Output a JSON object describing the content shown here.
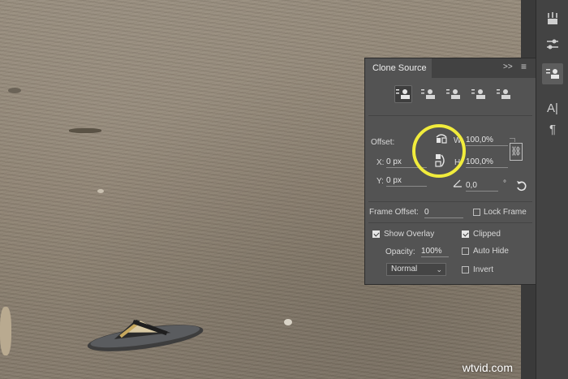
{
  "toolbar": {
    "icons": [
      "brush-presets-icon",
      "adjust-sliders-icon",
      "clone-source-icon",
      "character-icon",
      "paragraph-icon"
    ],
    "character_glyph": "A|",
    "paragraph_glyph": "¶"
  },
  "panel": {
    "title": "Clone Source",
    "expand_glyph": ">>",
    "menu_glyph": "≡",
    "clone_sources": [
      "clone-source-1",
      "clone-source-2",
      "clone-source-3",
      "clone-source-4",
      "clone-source-5"
    ],
    "active_source_index": 0,
    "offset": {
      "label": "Offset:",
      "x_label": "X:",
      "x_value": "0 px",
      "y_label": "Y:",
      "y_value": "0 px",
      "w_label": "W:",
      "w_value": "100,0%",
      "h_label": "H:",
      "h_value": "100,0%",
      "angle_value": "0,0",
      "angle_unit": "°"
    },
    "frame": {
      "offset_label": "Frame Offset:",
      "offset_value": "0",
      "lock_label": "Lock Frame",
      "lock_checked": false
    },
    "overlay": {
      "show_label": "Show Overlay",
      "show_checked": true,
      "clipped_label": "Clipped",
      "clipped_checked": true,
      "opacity_label": "Opacity:",
      "opacity_value": "100%",
      "auto_hide_label": "Auto Hide",
      "auto_hide_checked": false,
      "mode_value": "Normal",
      "invert_label": "Invert",
      "invert_checked": false
    }
  },
  "highlight_color": "#f1ec3c",
  "watermark": "wtvid.com"
}
